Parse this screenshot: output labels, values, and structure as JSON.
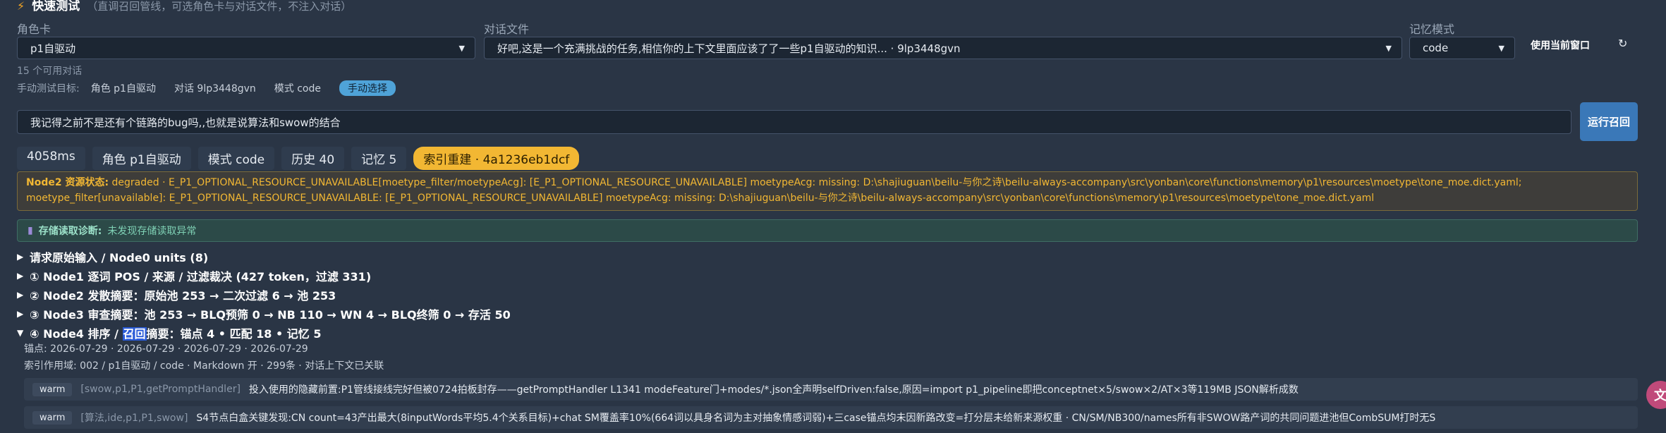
{
  "header": {
    "title": "快速测试",
    "hint": "（直调召回管线，可选角色卡与对话文件，不注入对话）"
  },
  "fields": {
    "role_label": "角色卡",
    "role_value": "p1自驱动",
    "dialog_label": "对话文件",
    "dialog_value": "好吧,这是一个充满挑战的任务,相信你的上下文里面应该了了一些p1自驱动的知识... · 9lp3448gvn",
    "mode_label": "记忆模式",
    "mode_value": "code",
    "use_window_label": "使用当前窗口",
    "available_count": "15 个可用对话"
  },
  "target": {
    "label": "手动测试目标:",
    "role": "角色 p1自驱动",
    "dialog": "对话 9lp3448gvn",
    "mode": "模式 code",
    "manual": "手动选择"
  },
  "query": {
    "value": "我记得之前不是还有个链路的bug吗,,也就是说算法和swow的结合",
    "run_label": "运行召回"
  },
  "stats": [
    "4058ms",
    "角色 p1自驱动",
    "模式 code",
    "历史 40",
    "记忆 5"
  ],
  "index_badge": "索引重建 · 4a1236eb1dcf",
  "warning": {
    "label": "Node2 资源状态:",
    "text": "degraded · E_P1_OPTIONAL_RESOURCE_UNAVAILABLE[moetype_filter/moetypeAcg]: [E_P1_OPTIONAL_RESOURCE_UNAVAILABLE] moetypeAcg: missing: D:\\shajiuguan\\beilu-与你之诗\\beilu-always-accompany\\src\\yonban\\core\\functions\\memory\\p1\\resources\\moetype\\tone_moe.dict.yaml; moetype_filter[unavailable]: E_P1_OPTIONAL_RESOURCE_UNAVAILABLE: [E_P1_OPTIONAL_RESOURCE_UNAVAILABLE] moetypeAcg: missing: D:\\shajiuguan\\beilu-与你之诗\\beilu-always-accompany\\src\\yonban\\core\\functions\\memory\\p1\\resources\\moetype\\tone_moe.dict.yaml"
  },
  "diagnosis": {
    "label": "存储读取诊断:",
    "text": "未发现存储读取异常"
  },
  "nodes": [
    {
      "arrow": "▶",
      "text": "请求原始输入 / Node0 units (8)"
    },
    {
      "arrow": "▶",
      "text": "① Node1 逐词 POS / 来源 / 过滤裁决 (427 token，过滤 331)"
    },
    {
      "arrow": "▶",
      "text": "② Node2 发散摘要：原始池 253 → 二次过滤 6 → 池 253"
    },
    {
      "arrow": "▶",
      "text": "③ Node3 审查摘要：池 253 → BLQ预筛 0 → NB 110 → WN 4 → BLQ终筛 0 → 存活 50"
    }
  ],
  "node4": {
    "arrow": "▼",
    "prefix": "④ Node4 排序 / ",
    "highlight": "召回",
    "suffix": "摘要：锚点 4 • 匹配 18 • 记忆 5",
    "anchor_label": "锚点:",
    "anchor_dates": "2026-07-29 · 2026-07-29 · 2026-07-29 · 2026-07-29",
    "scope": "索引作用域: 002 / p1自驱动 / code · Markdown 开 · 299条 · 对话上下文已关联"
  },
  "logs": [
    {
      "level": "warm",
      "tag": "[swow,p1,P1,getPromptHandler]",
      "text": "投入使用的隐藏前置:P1管线接线完好但被0724拍板封存——getPromptHandler L1341 modeFeature门+modes/*.json全声明selfDriven:false,原因=import p1_pipeline即把conceptnet×5/swow×2/AT×3等119MB JSON解析成数"
    },
    {
      "level": "warm",
      "tag": "[算法,ide,p1,P1,swow]",
      "text": "S4节点白盒关键发现:CN count=43产出最大(8inputWords平均5.4个关系目标)+chat SM覆盖率10%(664词以具身名词为主对抽象情感词弱)+三case锚点均未因新路改变=打分层未给新来源权重 · CN/SM/NB300/names所有非SWOW路产词的共同问题进池但CombSUM打时无S"
    }
  ],
  "corner_icon": "文"
}
